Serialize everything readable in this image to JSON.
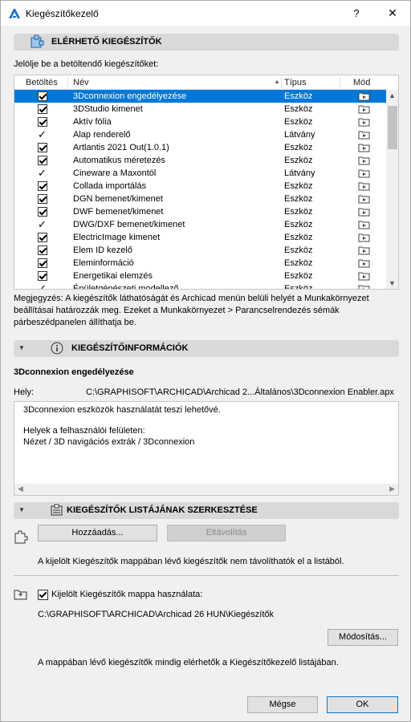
{
  "window": {
    "title": "Kiegészítőkezelő",
    "help": "?",
    "close": "✕"
  },
  "available": {
    "section_title": "ELÉRHETŐ KIEGÉSZÍTŐK",
    "instruction": "Jelölje be a betöltendő kiegészítőket:",
    "columns": {
      "load": "Betöltés",
      "name": "Név",
      "type": "Típus",
      "mode": "Mód"
    },
    "rows": [
      {
        "name": "3Dconnexion engedélyezése",
        "type": "Eszköz",
        "checked": "box",
        "selected": true
      },
      {
        "name": "3DStudio kimenet",
        "type": "Eszköz",
        "checked": "box"
      },
      {
        "name": "Aktív fólia",
        "type": "Eszköz",
        "checked": "box"
      },
      {
        "name": "Alap renderelő",
        "type": "Látvány",
        "checked": "tick"
      },
      {
        "name": "Artlantis 2021 Out(1.0.1)",
        "type": "Eszköz",
        "checked": "box"
      },
      {
        "name": "Automatikus méretezés",
        "type": "Eszköz",
        "checked": "box"
      },
      {
        "name": "Cineware a Maxontól",
        "type": "Látvány",
        "checked": "tick"
      },
      {
        "name": "Collada importálás",
        "type": "Eszköz",
        "checked": "box"
      },
      {
        "name": "DGN bemenet/kimenet",
        "type": "Eszköz",
        "checked": "box"
      },
      {
        "name": "DWF bemenet/kimenet",
        "type": "Eszköz",
        "checked": "box"
      },
      {
        "name": "DWG/DXF bemenet/kimenet",
        "type": "Eszköz",
        "checked": "tick"
      },
      {
        "name": "ElectricImage kimenet",
        "type": "Eszköz",
        "checked": "box"
      },
      {
        "name": "Elem ID kezelő",
        "type": "Eszköz",
        "checked": "box"
      },
      {
        "name": "Eleminformáció",
        "type": "Eszköz",
        "checked": "box"
      },
      {
        "name": "Energetikai elemzés",
        "type": "Eszköz",
        "checked": "box"
      },
      {
        "name": "Épületgépészeti modellező",
        "type": "Eszköz",
        "checked": "tick"
      }
    ],
    "note": "Megjegyzés: A kiegészítők láthatóságát és Archicad menün belüli helyét a Munkakörnyezet beállításai határozzák meg. Ezeket a Munkakörnyezet > Parancselrendezés sémák párbeszédpanelen állíthatja be."
  },
  "info": {
    "section_title": "KIEGÉSZÍTŐINFORMÁCIÓK",
    "name": "3Dconnexion engedélyezése",
    "location_label": "Hely:",
    "location_value": "C:\\GRAPHISOFT\\ARCHICAD\\Archicad 2...Általános\\3Dconnexion Enabler.apx",
    "description_lines": [
      "3Dconnexion eszközök használatát teszi lehetővé.",
      "",
      "Helyek a felhasználói felületen:",
      "Nézet / 3D navigációs extrák / 3Dconnexion"
    ]
  },
  "edit": {
    "section_title": "KIEGÉSZÍTŐK LISTÁJÁNAK SZERKESZTÉSE",
    "add_label": "Hozzáadás...",
    "remove_label": "Eltávolítás",
    "remove_note": "A kijelölt Kiegészítők mappában lévő kiegészítők nem távolíthatók el a listából.",
    "use_folder_label": "Kijelölt Kiegészítők mappa használata:",
    "folder_path": "C:\\GRAPHISOFT\\ARCHICAD\\Archicad 26 HUN\\Kiegészítők",
    "modify_label": "Módosítás...",
    "folder_note": "A mappában lévő kiegészítők mindig elérhetők a Kiegészítőkezelő listájában."
  },
  "footer": {
    "cancel": "Mégse",
    "ok": "OK"
  },
  "colors": {
    "selection": "#0078d7",
    "section_bg": "#d9d9d9",
    "dialog_bg": "#f0f0f0"
  }
}
